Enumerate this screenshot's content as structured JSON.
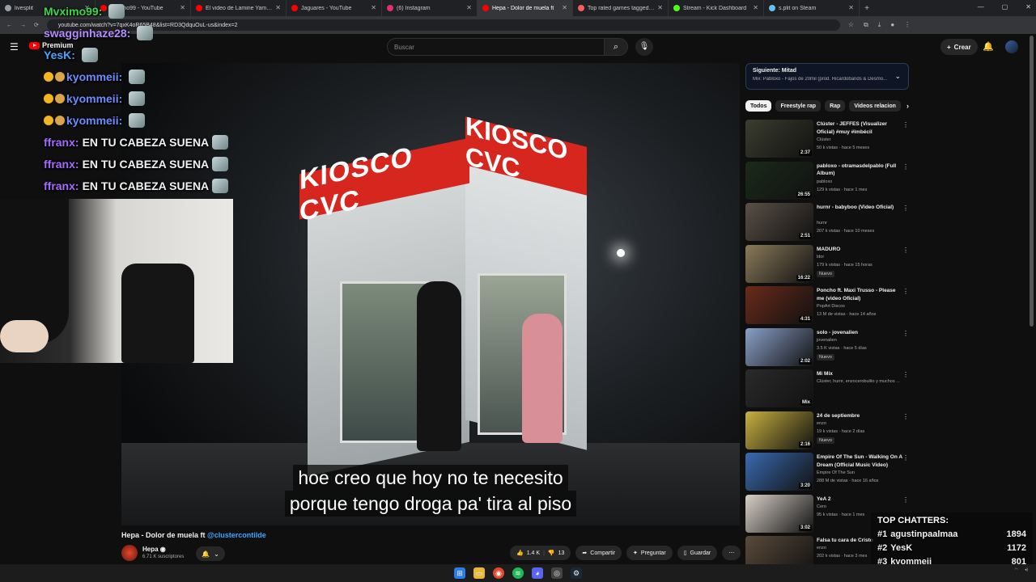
{
  "browser": {
    "tabs": [
      {
        "title": "livesplit",
        "color": "#9aa0a6"
      },
      {
        "title": "Mvximo99 - YouTube",
        "color": "#ff0000"
      },
      {
        "title": "El video de Lamine Yamal edita",
        "color": "#ff0000"
      },
      {
        "title": "Jaguares - YouTube",
        "color": "#ff0000"
      },
      {
        "title": "(6) Instagram",
        "color": "#e1306c"
      },
      {
        "title": "Hepa - Dolor de muela ft",
        "color": "#ff0000",
        "active": true
      },
      {
        "title": "Top rated games tagged Psych",
        "color": "#fa5c5c"
      },
      {
        "title": "Stream - Kick Dashboard",
        "color": "#53fc18"
      },
      {
        "title": "s.plit on Steam",
        "color": "#66c0f4"
      }
    ],
    "url": "youtube.com/watch?v=7qxK4oR65B48&list=RD3QdquOuL-us&index=2",
    "new_tab": "+"
  },
  "youtube": {
    "logo_text": "Premium",
    "search_placeholder": "Buscar",
    "create_label": "Crear"
  },
  "chat_overlay": [
    {
      "name": "Mvximo99:",
      "color": "#3ad84a",
      "text": ""
    },
    {
      "name": "swagginhaze28:",
      "color": "#b58cff",
      "text": ""
    },
    {
      "name": "YesK:",
      "color": "#4aa3ff",
      "text": ""
    },
    {
      "name": "kyommeii:",
      "color": "#6b8cff",
      "text": ""
    },
    {
      "name": "kyommeii:",
      "color": "#6b8cff",
      "text": ""
    },
    {
      "name": "kyommeii:",
      "color": "#6b8cff",
      "text": ""
    },
    {
      "name": "ffranx:",
      "color": "#a46bff",
      "text": "EN TU CABEZA SUENA"
    },
    {
      "name": "ffranx:",
      "color": "#a46bff",
      "text": "EN TU CABEZA SUENA"
    },
    {
      "name": "ffranx:",
      "color": "#a46bff",
      "text": "EN TU CABEZA SUENA"
    }
  ],
  "video": {
    "sign_text": "KIOSCO CVC",
    "subtitle_line1": "hoe creo que hoy no te necesito",
    "subtitle_line2": "porque tengo droga pa' tira al piso",
    "title": "Hepa - Dolor de muela ft ",
    "title_link": "@clustercontilde",
    "channel": "Hepa",
    "subscribers": "6.71 K suscriptores",
    "likes": "1.4 K",
    "dislikes": "13",
    "share_label": "Compartir",
    "ask_label": "Preguntar",
    "save_label": "Guardar"
  },
  "sidebar": {
    "next_label": "Siguiente: Mitad",
    "next_sub": "Mix: Pabloxo - Fajos de 20mil (prod. Ricardobands & Desmo...",
    "chips": [
      "Todos",
      "Freestyle rap",
      "Rap",
      "Videos relacion"
    ],
    "recommendations": [
      {
        "title": "Clúster - JEFFES (Visualizer Oficial) #muy #imbécil",
        "channel": "Clúster",
        "meta": "50 k vistas · hace 5 meses",
        "duration": "2:37",
        "badge": "",
        "thumb": "#3b3d2f"
      },
      {
        "title": "pabloxo - otramasdelpablo (Full Album)",
        "channel": "pabloxo",
        "meta": "129 k vistas · hace 1 mes",
        "duration": "26:55",
        "badge": "",
        "thumb": "#1a2a1a"
      },
      {
        "title": "hurnr - babyboo (Video Oficial)",
        "channel": "hurnr",
        "meta": "207 k vistas · hace 10 meses",
        "duration": "2:51",
        "badge": "",
        "thumb": "#5a5046"
      },
      {
        "title": "MADURO",
        "channel": "ldor",
        "meta": "179 k vistas · hace 15 horas",
        "duration": "16:22",
        "badge": "Nuevo",
        "thumb": "#8a7a5a"
      },
      {
        "title": "Poncho ft. Maxi Trusso - Please me (video Oficial)",
        "channel": "PopArt Discos",
        "meta": "13 M de vistas · hace 14 años",
        "duration": "4:31",
        "badge": "",
        "thumb": "#6a2a1a"
      },
      {
        "title": "solo - jovenalien",
        "channel": "jovenalien",
        "meta": "3.5 K vistas · hace 5 días",
        "duration": "2:02",
        "badge": "Nuevo",
        "thumb": "#8aa0c8"
      },
      {
        "title": "Mi Mix",
        "channel": "Clúster, hurnr, enzocerobulito y muchos ...",
        "meta": "",
        "duration": "Mix",
        "badge": "",
        "thumb": "#2a2a2a"
      },
      {
        "title": "24 de septiembre",
        "channel": "enzo",
        "meta": "19 k vistas · hace 2 días",
        "duration": "2:16",
        "badge": "Nuevo",
        "thumb": "#c8b040"
      },
      {
        "title": "Empire Of The Sun - Walking On A Dream (Official Music Video)",
        "channel": "Empire Of The Sun",
        "meta": "288 M de vistas · hace 16 años",
        "duration": "3:20",
        "badge": "",
        "thumb": "#3a6ab0"
      },
      {
        "title": "YeA 2",
        "channel": "Cero",
        "meta": "95 k vistas · hace 1 mes",
        "duration": "3:02",
        "badge": "",
        "thumb": "#d8d0c8"
      },
      {
        "title": "Falsa tu cara de Cristo",
        "channel": "enzo",
        "meta": "202 k vistas · hace 3 mes",
        "duration": "",
        "badge": "",
        "thumb": "#5a4a3a"
      }
    ]
  },
  "top_chatters": {
    "heading": "TOP CHATTERS:",
    "rows": [
      {
        "rank": "#1",
        "name": "agustinpaalmaa",
        "count": "1894"
      },
      {
        "rank": "#2",
        "name": "YesK",
        "count": "1172"
      },
      {
        "rank": "#3",
        "name": "kyommeii",
        "count": "801"
      }
    ]
  }
}
